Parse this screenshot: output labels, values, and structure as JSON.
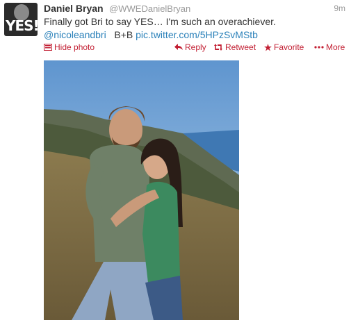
{
  "tweet": {
    "name": "Daniel Bryan",
    "handle": "@WWEDanielBryan",
    "time": "9m",
    "text_line1": "Finally got Bri to say YES… I'm such an overachiever.",
    "mention": "@nicoleandbri",
    "mid_text": "B+B",
    "link": "pic.twitter.com/5HPzSvMStb"
  },
  "avatar": {
    "label": "YES!"
  },
  "actions": {
    "hide_photo": "Hide photo",
    "reply": "Reply",
    "retweet": "Retweet",
    "favorite": "Favorite",
    "more": "More"
  },
  "colors": {
    "action_red": "#c21e32",
    "link_blue": "#2a80b9",
    "muted": "#999999"
  },
  "icons": [
    "photo-icon",
    "reply-icon",
    "retweet-icon",
    "favorite-icon",
    "more-icon"
  ]
}
